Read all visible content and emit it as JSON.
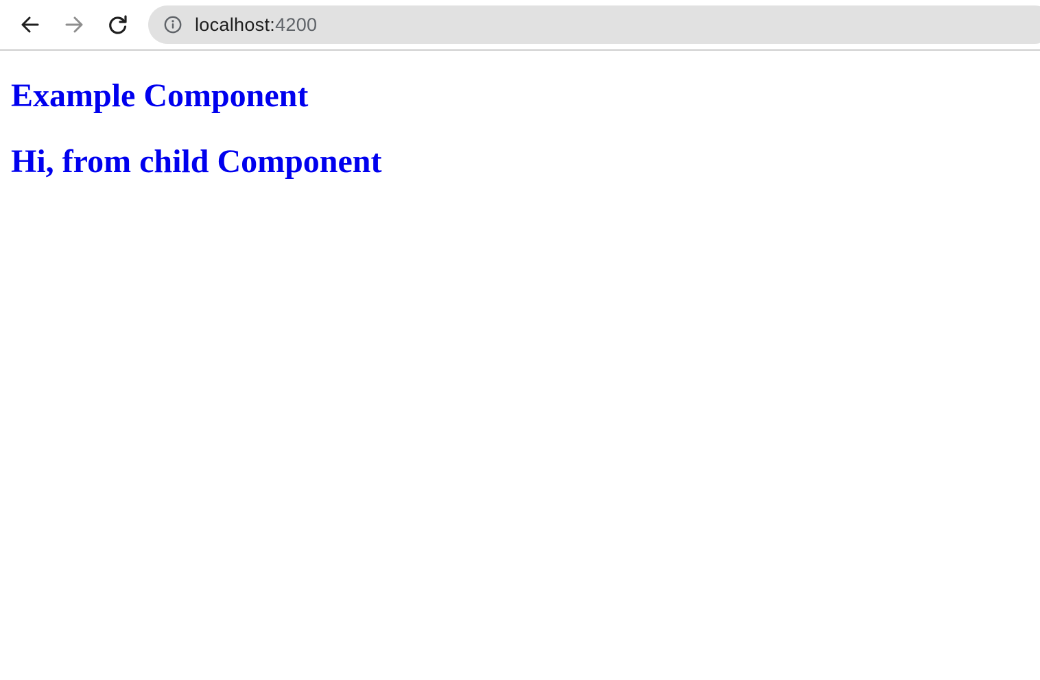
{
  "browser": {
    "url_host": "localhost:",
    "url_port": "4200",
    "icons": {
      "back": "arrow-left-icon",
      "forward": "arrow-right-icon",
      "reload": "reload-icon",
      "site_info": "info-icon"
    },
    "colors": {
      "address_bar_bg": "#e1e1e1",
      "forward_disabled": "#8e8e8e"
    }
  },
  "page": {
    "heading_example": "Example Component",
    "heading_child": "Hi, from child Component",
    "text_color": "#0000ee"
  }
}
